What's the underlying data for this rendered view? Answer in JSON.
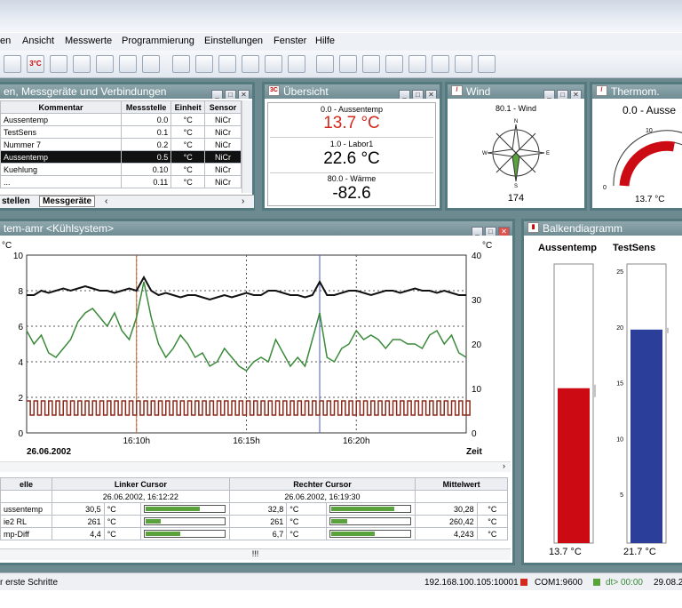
{
  "menu": [
    "en",
    "Ansicht",
    "Messwerte",
    "Programmierung",
    "Einstellungen",
    "Fenster",
    "Hilfe"
  ],
  "toolbar_icons": [
    "settings-icon",
    "3c-icon",
    "chart-icon",
    "table-icon",
    "export-icon",
    "graph-icon",
    "save-icon",
    "open-folder-icon",
    "floppy-icon",
    "print-preview-icon",
    "edit-icon",
    "copy-icon",
    "tv-icon",
    "bell-icon",
    "network-icon",
    "clock-icon",
    "pen-icon",
    "zoom-icon",
    "printer-icon",
    "device-icon",
    "wand-icon"
  ],
  "toolbar_labels": {
    "c3": "3°C"
  },
  "win_sensors": {
    "title": "en, Messgeräte und Verbindungen",
    "headers": [
      "Kommentar",
      "Messstelle",
      "Einheit",
      "Sensor"
    ],
    "rows": [
      [
        "Aussentemp",
        "0.0",
        "°C",
        "NiCr"
      ],
      [
        "TestSens",
        "0.1",
        "°C",
        "NiCr"
      ],
      [
        "Nummer 7",
        "0.2",
        "°C",
        "NiCr"
      ],
      [
        "Aussentemp",
        "0.5",
        "°C",
        "NiCr"
      ],
      [
        "Kuehlung",
        "0.10",
        "°C",
        "NiCr"
      ],
      [
        "...",
        "0.11",
        "°C",
        "NiCr"
      ]
    ],
    "tab1": "stellen",
    "tab2": "Messgeräte"
  },
  "win_overview": {
    "title": "Übersicht",
    "items": [
      {
        "label": "0.0 - Aussentemp",
        "value": "13.7 °C"
      },
      {
        "label": "1.0 - Labor1",
        "value": "22.6 °C"
      },
      {
        "label": "80.0 - Wärme",
        "value": "-82.6"
      }
    ]
  },
  "win_wind": {
    "title": "Wind",
    "label": "80.1 - Wind",
    "value": "174",
    "n": "N",
    "e": "E",
    "s": "S",
    "w": "W"
  },
  "win_thermo": {
    "title": "Thermom.",
    "label": "0.0 - Ausse",
    "scale_min": "0",
    "scale_mid": "10",
    "value": "13.7 °C"
  },
  "win_chart": {
    "title": "tem-amr <Kühlsystem>",
    "left_unit": "°C",
    "right_unit": "°C",
    "left_ticks": [
      "10",
      "8",
      "6",
      "4",
      "2",
      "0"
    ],
    "right_ticks": [
      "40",
      "30",
      "20",
      "10",
      "0"
    ],
    "x_ticks": [
      "16:10h",
      "16:15h",
      "16:20h"
    ],
    "date": "26.06.2002",
    "x_label": "Zeit"
  },
  "chart_data": {
    "type": "line",
    "x": [
      0,
      1,
      2,
      3,
      4,
      5,
      6,
      7,
      8,
      9,
      10,
      11,
      12,
      13,
      14,
      15,
      16,
      17,
      18,
      19,
      20,
      21,
      22,
      23,
      24,
      25,
      26,
      27,
      28,
      29,
      30,
      31,
      32,
      33,
      34,
      35,
      36,
      37,
      38,
      39,
      40,
      41,
      42,
      43,
      44,
      45,
      46,
      47,
      48,
      49,
      50,
      51,
      52,
      53,
      54,
      55,
      56,
      57,
      58,
      59,
      60
    ],
    "series": [
      {
        "axis": "right",
        "color": "#111111",
        "values": [
          31,
          31,
          32,
          31.5,
          32,
          32.5,
          32,
          32.5,
          33,
          32.5,
          32,
          32,
          31.5,
          32,
          32.5,
          32,
          35,
          32,
          31,
          31.5,
          31,
          30.5,
          31,
          31,
          30.5,
          30,
          30.5,
          31,
          30.5,
          31,
          31.5,
          31,
          31,
          32,
          32,
          31.5,
          31,
          31,
          30.5,
          31,
          34,
          31,
          31,
          31.5,
          32,
          32,
          31.5,
          31,
          31.5,
          32,
          32,
          31.5,
          32,
          32.5,
          32,
          32,
          31.5,
          32,
          31.5,
          31,
          31
        ]
      },
      {
        "axis": "right",
        "color": "#3a8a3a",
        "values": [
          23,
          20,
          22,
          18,
          17,
          19,
          21,
          25,
          27,
          28,
          26,
          24,
          27,
          23,
          21,
          26,
          34,
          26,
          20,
          17,
          19,
          22,
          20,
          17,
          18,
          15,
          16,
          19,
          17,
          15,
          14,
          16,
          17,
          16,
          21,
          18,
          15,
          17,
          15,
          21,
          27,
          17,
          16,
          19,
          20,
          23,
          21,
          22,
          21,
          19,
          21,
          21,
          20,
          20,
          19,
          22,
          23,
          20,
          22,
          18,
          17
        ]
      },
      {
        "axis": "left",
        "color": "#8a2a1a",
        "values": [
          1.8,
          1.8,
          1.8,
          1.8,
          1.8,
          1.8,
          1.8,
          1.8,
          1.8,
          1.8,
          1.8,
          1.8,
          1.8,
          1.8,
          1.8,
          1.8,
          1.8,
          1.8,
          1.8,
          1.8,
          1.8,
          1.8,
          1.8,
          1.8,
          1.8,
          1.8,
          1.8,
          1.8,
          1.8,
          1.8,
          1.8,
          1.8,
          1.8,
          1.8,
          1.8,
          1.8,
          1.8,
          1.8,
          1.8,
          1.8,
          1.8,
          1.8,
          1.8,
          1.8,
          1.8,
          1.8,
          1.8,
          1.8,
          1.8,
          1.8,
          1.8,
          1.8,
          1.8,
          1.8,
          1.8,
          1.8,
          1.8,
          1.8,
          1.8,
          1.8,
          1.8
        ]
      }
    ],
    "cursor_left_x": 15,
    "cursor_right_x": 40,
    "ylim_left": [
      0,
      10
    ],
    "ylim_right": [
      0,
      40
    ],
    "grid": true
  },
  "win_table": {
    "headers": [
      "elle",
      "Linker Cursor",
      "Rechter Cursor",
      "Mittelwert"
    ],
    "date_left": "26.06.2002, 16:12:22",
    "date_right": "26.06.2002, 16:19:30",
    "rows": [
      {
        "name": "ussentemp",
        "lv": "30,5",
        "lu": "°C",
        "lf": 0.7,
        "rv": "32,8",
        "ru": "°C",
        "rf": 0.8,
        "mv": "30,28",
        "mu": "°C"
      },
      {
        "name": "ie2 RL",
        "lv": "261",
        "lu": "°C",
        "lf": 0.2,
        "rv": "261",
        "ru": "°C",
        "rf": 0.2,
        "mv": "260,42",
        "mu": "°C"
      },
      {
        "name": "mp-Diff",
        "lv": "4,4",
        "lu": "°C",
        "lf": 0.45,
        "rv": "6,7",
        "ru": "°C",
        "rf": 0.55,
        "mv": "4,243",
        "mu": "°C"
      }
    ],
    "scroll": "!!!"
  },
  "win_bars": {
    "title": "Balkendiagramm",
    "bar1_label": "Aussentemp",
    "bar2_label": "TestSens",
    "bar1_value": "13.7 °C",
    "bar2_value": "21.7 °C",
    "bar1_frac": 0.555,
    "bar2_frac": 0.765,
    "ticks": [
      "25",
      "20",
      "15",
      "10",
      "5",
      "0"
    ],
    "bar1_color": "#cc0a14",
    "bar2_color": "#2b3f9a"
  },
  "status": {
    "left": "r erste Schritte",
    "ip": "192.168.100.105:10001",
    "com": "COM1:9600",
    "dt": "dt> 00:00",
    "date": "29.08.2"
  }
}
